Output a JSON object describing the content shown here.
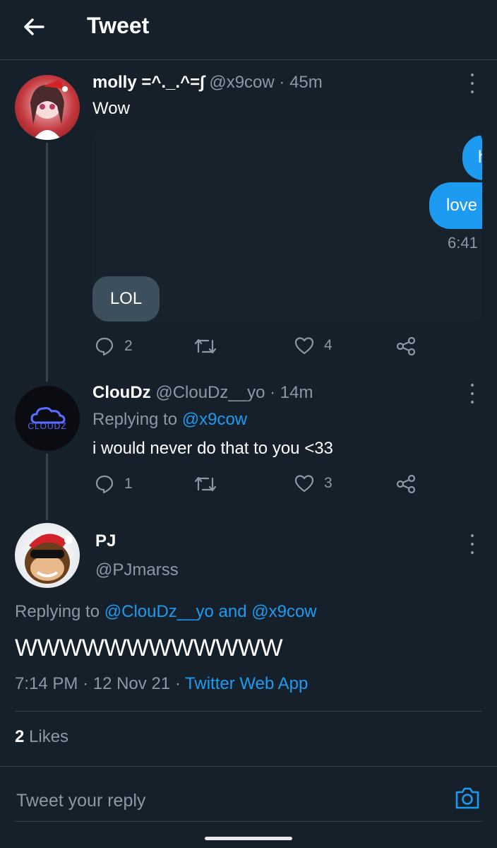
{
  "header": {
    "title": "Tweet"
  },
  "tweet1": {
    "display_name": "molly =^._.^=∫",
    "handle": "@x9cow",
    "time": "· 45m",
    "text": "Wow",
    "media": {
      "bubble_top": "h",
      "bubble_mid": "love",
      "bubble_time": "6:41",
      "bubble_reply": "LOL"
    },
    "replies": "2",
    "likes": "4"
  },
  "tweet2": {
    "display_name": "ClouDz",
    "handle": "@ClouDz__yo",
    "time": "· 14m",
    "replying_prefix": "Replying to",
    "replying_to": "@x9cow",
    "text": "i would never do that to you <33",
    "avatar_logo_text": "CLOUDZ",
    "replies": "1",
    "likes": "3"
  },
  "main_tweet": {
    "display_name": "PJ",
    "handle": "@PJmarss",
    "replying_prefix": "Replying to",
    "replying_to": "@ClouDz__yo and @x9cow",
    "text": "WWWWWWWWWWWW",
    "time": "7:14 PM",
    "date": "12 Nov 21",
    "source": "Twitter Web App",
    "likes_count": "2",
    "likes_label": "Likes"
  },
  "reply_bar": {
    "placeholder": "Tweet your reply"
  },
  "colors": {
    "background": "#15202b",
    "accent": "#1d9bf0",
    "muted": "#8b98a5",
    "divider": "#38444d"
  }
}
